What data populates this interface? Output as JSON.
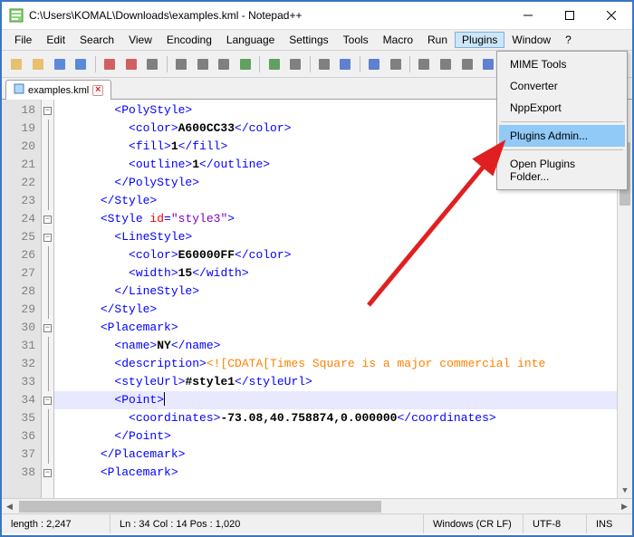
{
  "window": {
    "title": "C:\\Users\\KOMAL\\Downloads\\examples.kml - Notepad++"
  },
  "menubar": [
    "File",
    "Edit",
    "Search",
    "View",
    "Encoding",
    "Language",
    "Settings",
    "Tools",
    "Macro",
    "Run",
    "Plugins",
    "Window",
    "?"
  ],
  "active_menu_index": 10,
  "tab": {
    "label": "examples.kml"
  },
  "dropdown": {
    "items": [
      "MIME Tools",
      "Converter",
      "NppExport",
      "Plugins Admin...",
      "Open Plugins Folder..."
    ],
    "highlighted_index": 3,
    "separators_before": [
      3,
      4
    ]
  },
  "lines": [
    {
      "n": 18,
      "indent": 4,
      "fold": "minus",
      "tokens": [
        {
          "t": "tag",
          "v": "<PolyStyle>"
        }
      ]
    },
    {
      "n": 19,
      "indent": 5,
      "tokens": [
        {
          "t": "tag",
          "v": "<color>"
        },
        {
          "t": "txt",
          "v": "A600CC33"
        },
        {
          "t": "tag",
          "v": "</color>"
        }
      ]
    },
    {
      "n": 20,
      "indent": 5,
      "tokens": [
        {
          "t": "tag",
          "v": "<fill>"
        },
        {
          "t": "txt",
          "v": "1"
        },
        {
          "t": "tag",
          "v": "</fill>"
        }
      ]
    },
    {
      "n": 21,
      "indent": 5,
      "tokens": [
        {
          "t": "tag",
          "v": "<outline>"
        },
        {
          "t": "txt",
          "v": "1"
        },
        {
          "t": "tag",
          "v": "</outline>"
        }
      ]
    },
    {
      "n": 22,
      "indent": 4,
      "tokens": [
        {
          "t": "tag",
          "v": "</PolyStyle>"
        }
      ]
    },
    {
      "n": 23,
      "indent": 3,
      "tokens": [
        {
          "t": "tag",
          "v": "</Style>"
        }
      ]
    },
    {
      "n": 24,
      "indent": 3,
      "fold": "minus",
      "tokens": [
        {
          "t": "tag",
          "v": "<Style "
        },
        {
          "t": "attr",
          "v": "id"
        },
        {
          "t": "tag",
          "v": "="
        },
        {
          "t": "val",
          "v": "\"style3\""
        },
        {
          "t": "tag",
          "v": ">"
        }
      ]
    },
    {
      "n": 25,
      "indent": 4,
      "fold": "minus",
      "tokens": [
        {
          "t": "tag",
          "v": "<LineStyle>"
        }
      ]
    },
    {
      "n": 26,
      "indent": 5,
      "tokens": [
        {
          "t": "tag",
          "v": "<color>"
        },
        {
          "t": "txt",
          "v": "E60000FF"
        },
        {
          "t": "tag",
          "v": "</color>"
        }
      ]
    },
    {
      "n": 27,
      "indent": 5,
      "tokens": [
        {
          "t": "tag",
          "v": "<width>"
        },
        {
          "t": "txt",
          "v": "15"
        },
        {
          "t": "tag",
          "v": "</width>"
        }
      ]
    },
    {
      "n": 28,
      "indent": 4,
      "tokens": [
        {
          "t": "tag",
          "v": "</LineStyle>"
        }
      ]
    },
    {
      "n": 29,
      "indent": 3,
      "tokens": [
        {
          "t": "tag",
          "v": "</Style>"
        }
      ]
    },
    {
      "n": 30,
      "indent": 3,
      "fold": "minus",
      "tokens": [
        {
          "t": "tag",
          "v": "<Placemark>"
        }
      ]
    },
    {
      "n": 31,
      "indent": 4,
      "tokens": [
        {
          "t": "tag",
          "v": "<name>"
        },
        {
          "t": "txt",
          "v": "NY"
        },
        {
          "t": "tag",
          "v": "</name>"
        }
      ]
    },
    {
      "n": 32,
      "indent": 4,
      "tokens": [
        {
          "t": "tag",
          "v": "<description>"
        },
        {
          "t": "cdata",
          "v": "<![CDATA[Times Square is a major commercial inte"
        }
      ]
    },
    {
      "n": 33,
      "indent": 4,
      "tokens": [
        {
          "t": "tag",
          "v": "<styleUrl>"
        },
        {
          "t": "txt",
          "v": "#style1"
        },
        {
          "t": "tag",
          "v": "</styleUrl>"
        }
      ]
    },
    {
      "n": 34,
      "indent": 4,
      "fold": "minus",
      "hl": true,
      "caret": true,
      "tokens": [
        {
          "t": "tag",
          "v": "<Point>"
        }
      ]
    },
    {
      "n": 35,
      "indent": 5,
      "tokens": [
        {
          "t": "tag",
          "v": "<coordinates>"
        },
        {
          "t": "txt",
          "v": "-73.08,40.758874,0.000000"
        },
        {
          "t": "tag",
          "v": "</coordinates>"
        }
      ]
    },
    {
      "n": 36,
      "indent": 4,
      "tokens": [
        {
          "t": "tag",
          "v": "</Point>"
        }
      ]
    },
    {
      "n": 37,
      "indent": 3,
      "tokens": [
        {
          "t": "tag",
          "v": "</Placemark>"
        }
      ]
    },
    {
      "n": 38,
      "indent": 3,
      "fold": "minus",
      "tokens": [
        {
          "t": "tag",
          "v": "<Placemark>"
        }
      ]
    }
  ],
  "status": {
    "length": "length : 2,247",
    "pos": "Ln : 34    Col : 14    Pos : 1,020",
    "eol": "Windows (CR LF)",
    "enc": "UTF-8",
    "mode": "INS"
  },
  "toolbar_icons": [
    "new",
    "open",
    "save",
    "save-all",
    "close",
    "close-all",
    "print",
    "cut",
    "copy",
    "paste",
    "undo",
    "redo",
    "find",
    "replace",
    "zoom-in",
    "zoom-out",
    "sync",
    "wrap",
    "show-chars",
    "indent-guide",
    "doc-map",
    "func-list",
    "folder",
    "monitor",
    "record",
    "play"
  ]
}
